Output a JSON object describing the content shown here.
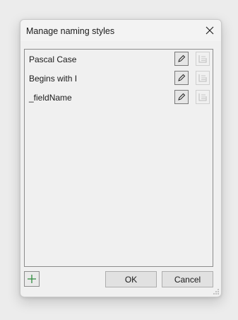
{
  "dialog": {
    "title": "Manage naming styles",
    "close_icon": "close-icon"
  },
  "styles": [
    {
      "label": "Pascal Case"
    },
    {
      "label": "Begins with I"
    },
    {
      "label": "_fieldName"
    }
  ],
  "icons": {
    "edit": "pencil-icon",
    "remove": "remove-icon",
    "add": "plus-icon"
  },
  "colors": {
    "add_icon": "#2e8b3d"
  },
  "buttons": {
    "ok_label": "OK",
    "cancel_label": "Cancel"
  }
}
